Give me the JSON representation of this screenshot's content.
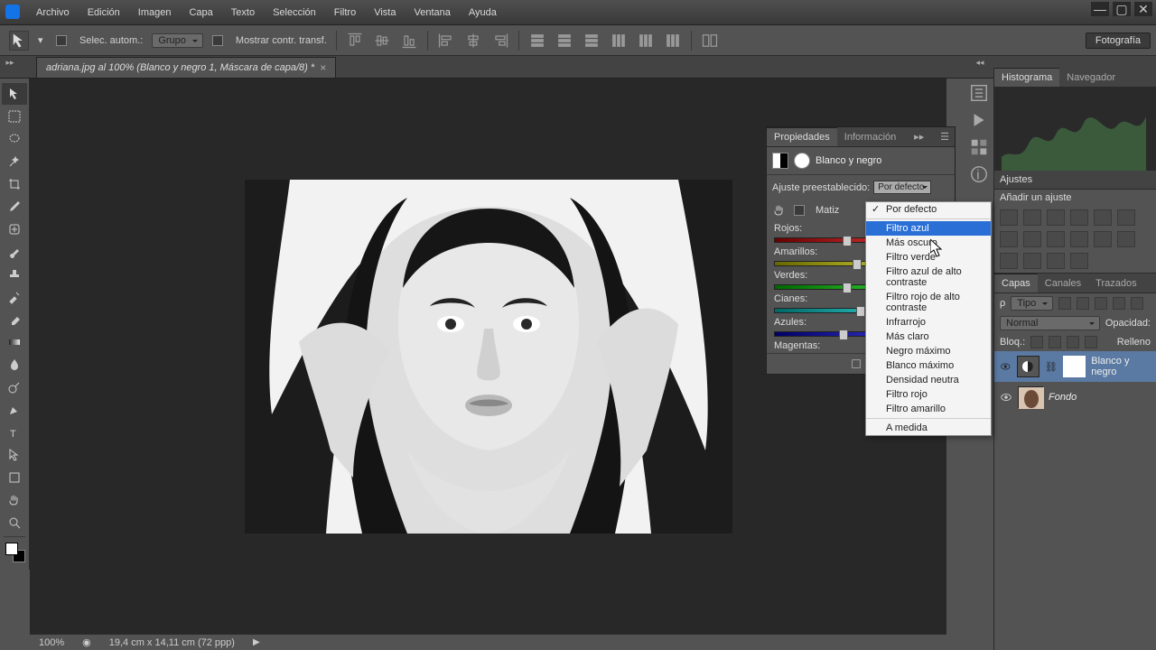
{
  "menu": {
    "items": [
      "Archivo",
      "Edición",
      "Imagen",
      "Capa",
      "Texto",
      "Selección",
      "Filtro",
      "Vista",
      "Ventana",
      "Ayuda"
    ]
  },
  "options": {
    "auto_select": "Selec. autom.:",
    "group": "Grupo",
    "show_transform": "Mostrar contr. transf.",
    "workspace": "Fotografía"
  },
  "tabs": {
    "doc": "adriana.jpg al 100% (Blanco y negro 1, Máscara de capa/8) *"
  },
  "status": {
    "zoom": "100%",
    "dims": "19,4 cm x 14,11 cm (72 ppp)"
  },
  "right": {
    "histogram": "Histograma",
    "navigator": "Navegador",
    "adjustments": "Ajustes",
    "add_adjust": "Añadir un ajuste",
    "layers": "Capas",
    "channels": "Canales",
    "paths": "Trazados",
    "kind": "Tipo",
    "blend": "Normal",
    "opacity": "Opacidad:",
    "lock": "Bloq.:",
    "fill": "Relleno",
    "layer_bw": "Blanco y negro",
    "layer_bg": "Fondo"
  },
  "props": {
    "tab_properties": "Propiedades",
    "tab_info": "Información",
    "bw_title": "Blanco y negro",
    "preset_label": "Ajuste preestablecido:",
    "preset_value": "Por defecto",
    "tint": "Matiz",
    "sliders": {
      "reds": "Rojos:",
      "yellows": "Amarillos:",
      "greens": "Verdes:",
      "cyans": "Cianes:",
      "blues": "Azules:",
      "magentas": "Magentas:"
    }
  },
  "dropdown": {
    "current": "Por defecto",
    "highlight": "Filtro azul",
    "items_after": [
      "Más oscuro",
      "Filtro verde",
      "Filtro azul de alto contraste",
      "Filtro rojo de alto contraste",
      "Infrarrojo",
      "Más claro",
      "Negro máximo",
      "Blanco máximo",
      "Densidad neutra",
      "Filtro rojo",
      "Filtro amarillo"
    ],
    "custom": "A medida"
  }
}
